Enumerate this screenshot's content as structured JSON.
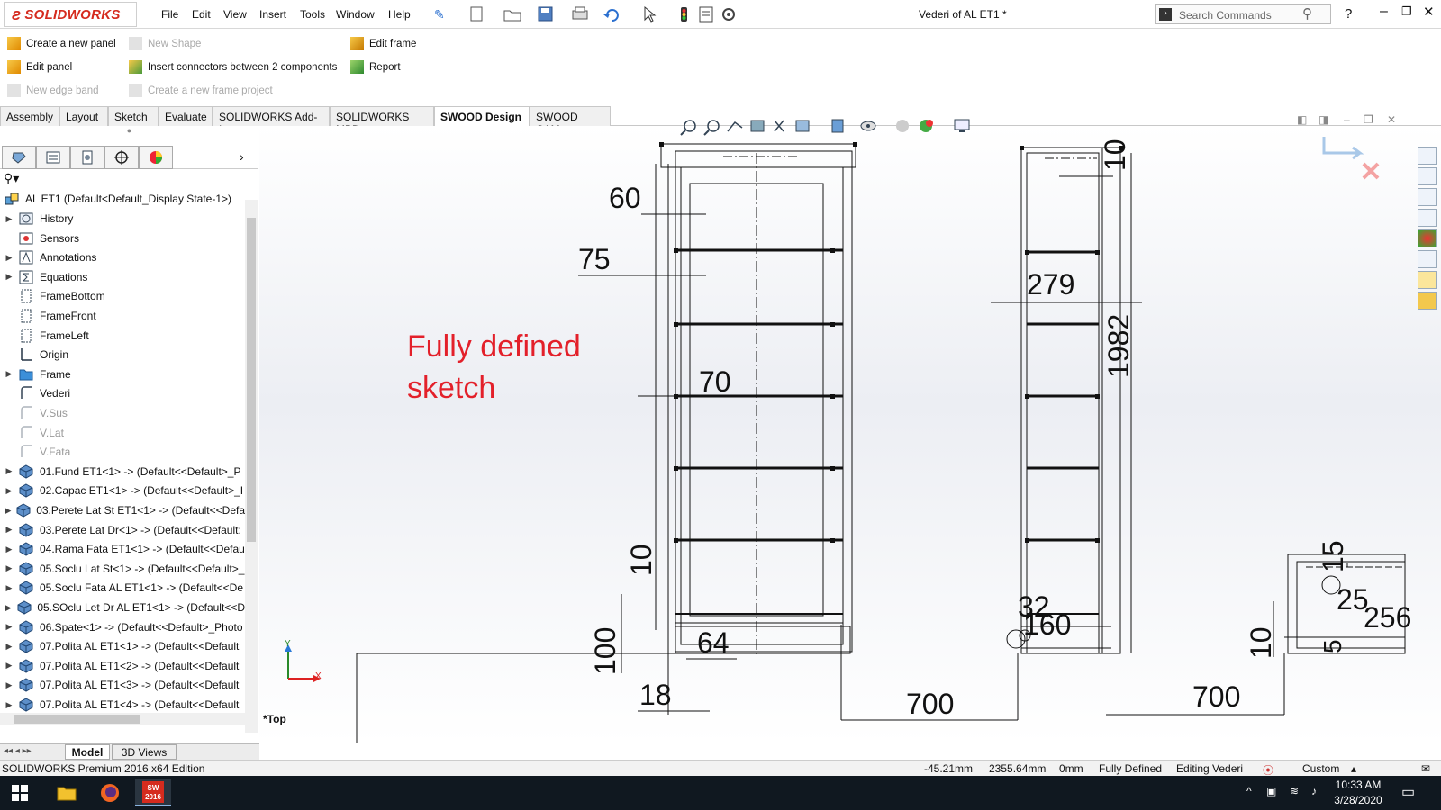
{
  "app": {
    "logo_text": "SOLIDWORKS",
    "window_title": "Vederi of AL ET1 *",
    "menu": [
      "File",
      "Edit",
      "View",
      "Insert",
      "Tools",
      "Window",
      "Help"
    ],
    "search_placeholder": "Search Commands",
    "help_symbol": "?"
  },
  "command_manager": {
    "col1": [
      {
        "label": "Create a new panel",
        "enabled": true
      },
      {
        "label": "Edit panel",
        "enabled": true
      },
      {
        "label": "New edge band",
        "enabled": false
      }
    ],
    "col2": [
      {
        "label": "New Shape",
        "enabled": false
      },
      {
        "label": "Insert connectors between 2 components",
        "enabled": true
      },
      {
        "label": "Create a new frame project",
        "enabled": false
      }
    ],
    "col3": [
      {
        "label": "Edit frame",
        "enabled": true
      },
      {
        "label": "Report",
        "enabled": true
      }
    ]
  },
  "tabs": [
    {
      "label": "Assembly",
      "active": false
    },
    {
      "label": "Layout",
      "active": false
    },
    {
      "label": "Sketch",
      "active": false
    },
    {
      "label": "Evaluate",
      "active": false
    },
    {
      "label": "SOLIDWORKS Add-Ins",
      "active": false
    },
    {
      "label": "SOLIDWORKS MBD",
      "active": false
    },
    {
      "label": "SWOOD Design",
      "active": true
    },
    {
      "label": "SWOOD CAM",
      "active": false
    }
  ],
  "tree": {
    "root": "AL ET1  (Default<Default_Display State-1>)",
    "items": [
      {
        "label": "History",
        "expandable": true,
        "dim": false,
        "icon": "history-icon"
      },
      {
        "label": "Sensors",
        "expandable": false,
        "dim": false,
        "icon": "sensor-icon"
      },
      {
        "label": "Annotations",
        "expandable": true,
        "dim": false,
        "icon": "annotation-icon"
      },
      {
        "label": "Equations",
        "expandable": true,
        "dim": false,
        "icon": "equation-icon"
      },
      {
        "label": "FrameBottom",
        "expandable": false,
        "dim": false,
        "icon": "plane-icon"
      },
      {
        "label": "FrameFront",
        "expandable": false,
        "dim": false,
        "icon": "plane-icon"
      },
      {
        "label": "FrameLeft",
        "expandable": false,
        "dim": false,
        "icon": "plane-icon"
      },
      {
        "label": "Origin",
        "expandable": false,
        "dim": false,
        "icon": "origin-icon"
      },
      {
        "label": "Frame",
        "expandable": true,
        "dim": false,
        "icon": "folder-icon"
      },
      {
        "label": "Vederi",
        "expandable": false,
        "dim": false,
        "icon": "sketch-icon"
      },
      {
        "label": "V.Sus",
        "expandable": false,
        "dim": true,
        "icon": "sketch-icon"
      },
      {
        "label": "V.Lat",
        "expandable": false,
        "dim": true,
        "icon": "sketch-icon"
      },
      {
        "label": "V.Fata",
        "expandable": false,
        "dim": true,
        "icon": "sketch-icon"
      },
      {
        "label": "01.Fund ET1<1> -> (Default<<Default>_P",
        "expandable": true,
        "dim": false,
        "icon": "part-icon"
      },
      {
        "label": "02.Capac ET1<1> -> (Default<<Default>_I",
        "expandable": true,
        "dim": false,
        "icon": "part-icon"
      },
      {
        "label": "03.Perete Lat St ET1<1> -> (Default<<Defa",
        "expandable": true,
        "dim": false,
        "icon": "part-icon"
      },
      {
        "label": "03.Perete Lat Dr<1> -> (Default<<Default:",
        "expandable": true,
        "dim": false,
        "icon": "part-icon"
      },
      {
        "label": "04.Rama Fata ET1<1> -> (Default<<Defau",
        "expandable": true,
        "dim": false,
        "icon": "part-icon"
      },
      {
        "label": "05.Soclu Lat St<1> -> (Default<<Default>_",
        "expandable": true,
        "dim": false,
        "icon": "part-icon"
      },
      {
        "label": "05.Soclu Fata AL ET1<1> -> (Default<<De",
        "expandable": true,
        "dim": false,
        "icon": "part-icon"
      },
      {
        "label": "05.SOclu Let Dr AL ET1<1> -> (Default<<D",
        "expandable": true,
        "dim": false,
        "icon": "part-icon"
      },
      {
        "label": "06.Spate<1> -> (Default<<Default>_Photo",
        "expandable": true,
        "dim": false,
        "icon": "part-icon"
      },
      {
        "label": "07.Polita AL ET1<1> -> (Default<<Default",
        "expandable": true,
        "dim": false,
        "icon": "part-icon"
      },
      {
        "label": "07.Polita AL ET1<2> -> (Default<<Default",
        "expandable": true,
        "dim": false,
        "icon": "part-icon"
      },
      {
        "label": "07.Polita AL ET1<3> -> (Default<<Default",
        "expandable": true,
        "dim": false,
        "icon": "part-icon"
      },
      {
        "label": "07.Polita AL ET1<4> -> (Default<<Default",
        "expandable": true,
        "dim": false,
        "icon": "part-icon"
      }
    ]
  },
  "bottom_tabs": [
    "Model",
    "3D Views"
  ],
  "viewport": {
    "annotation": [
      "Fully defined",
      "sketch"
    ],
    "view_label": "*Top",
    "dimensions": [
      "60",
      "75",
      "70",
      "10",
      "100",
      "64",
      "18",
      "700",
      "279",
      "1982",
      "10",
      "32",
      "160",
      "700",
      "15",
      "25",
      "256",
      "10",
      "5"
    ],
    "axis_x": "X",
    "axis_y": "Y"
  },
  "status": {
    "edition": "SOLIDWORKS Premium 2016 x64 Edition",
    "x": "-45.21mm",
    "y": "2355.64mm",
    "z": "0mm",
    "state": "Fully Defined",
    "editing": "Editing Vederi",
    "units": "Custom"
  },
  "taskbar": {
    "time": "10:33 AM",
    "date": "3/28/2020",
    "sw_badge": "2016"
  },
  "colors": {
    "brand_red": "#d52b1e",
    "annotation_red": "#e3202a",
    "taskbar": "#101820"
  }
}
